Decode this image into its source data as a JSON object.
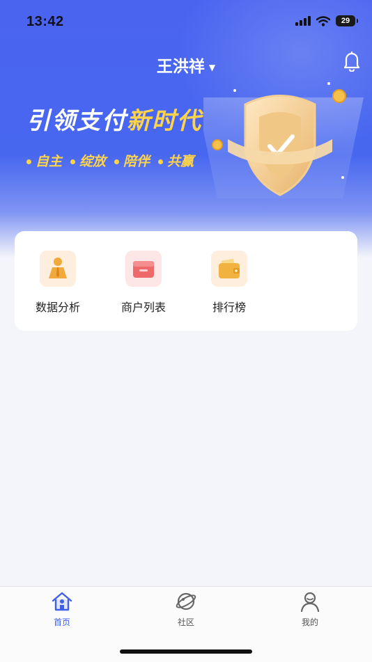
{
  "status_bar": {
    "time": "13:42",
    "battery": "29"
  },
  "header": {
    "user_name": "王洪祥"
  },
  "banner": {
    "slogan_main": "引领支付",
    "slogan_highlight": "新时代",
    "tags": [
      "自主",
      "绽放",
      "陪伴",
      "共赢"
    ]
  },
  "features": [
    {
      "label": "数据分析",
      "icon": "data-analysis-icon"
    },
    {
      "label": "商户列表",
      "icon": "merchant-list-icon"
    },
    {
      "label": "排行榜",
      "icon": "leaderboard-wallet-icon"
    }
  ],
  "tabbar": {
    "items": [
      {
        "label": "首页",
        "icon": "home-icon",
        "active": true
      },
      {
        "label": "社区",
        "icon": "planet-icon",
        "active": false
      },
      {
        "label": "我的",
        "icon": "profile-icon",
        "active": false
      }
    ]
  },
  "colors": {
    "primary_blue": "#4767ef",
    "accent_yellow": "#ffd44a",
    "active_tab": "#3f5fe8"
  }
}
